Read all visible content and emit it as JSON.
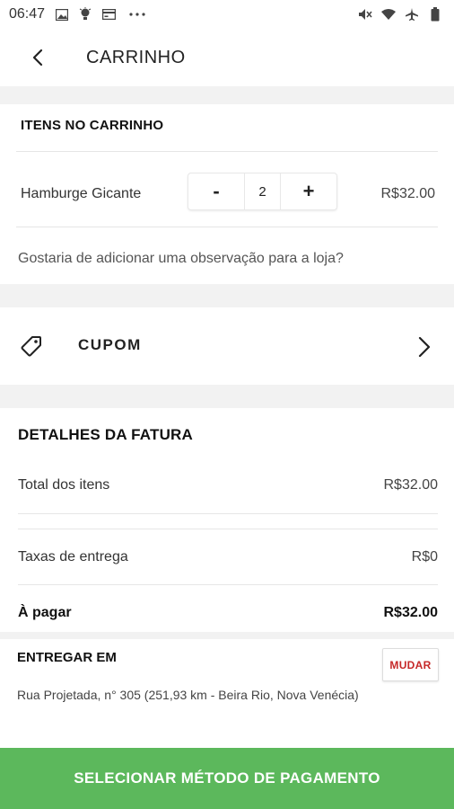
{
  "status_bar": {
    "time": "06:47",
    "left_icons": [
      "image-icon",
      "bulb-icon",
      "card-icon",
      "more-dots-icon"
    ],
    "right_icons": [
      "mute-icon",
      "wifi-icon",
      "airplane-icon",
      "battery-icon"
    ]
  },
  "header": {
    "title": "CARRINHO"
  },
  "cart": {
    "section_title": "ITENS NO CARRINHO",
    "items": [
      {
        "name": "Hamburge Gicante",
        "quantity": "2",
        "price": "R$32.00",
        "minus": "-",
        "plus": "+"
      }
    ],
    "note_prompt": "Gostaria de adicionar uma observação para a loja?"
  },
  "coupon": {
    "label": "CUPOM"
  },
  "invoice": {
    "title": "DETALHES DA FATURA",
    "rows": [
      {
        "label": "Total dos itens",
        "value": "R$32.00"
      },
      {
        "label": "Taxas de entrega",
        "value": "R$0"
      },
      {
        "label": "À pagar",
        "value": "R$32.00"
      }
    ]
  },
  "delivery": {
    "title": "ENTREGAR EM",
    "change_label": "MUDAR",
    "address": "Rua Projetada, n° 305 (251,93 km - Beira Rio, Nova Venécia)"
  },
  "footer": {
    "pay_button": "SELECIONAR MÉTODO DE PAGAMENTO"
  },
  "colors": {
    "accent_green": "#5cb85c",
    "change_red": "#c62828",
    "gap_gray": "#f2f2f2"
  }
}
